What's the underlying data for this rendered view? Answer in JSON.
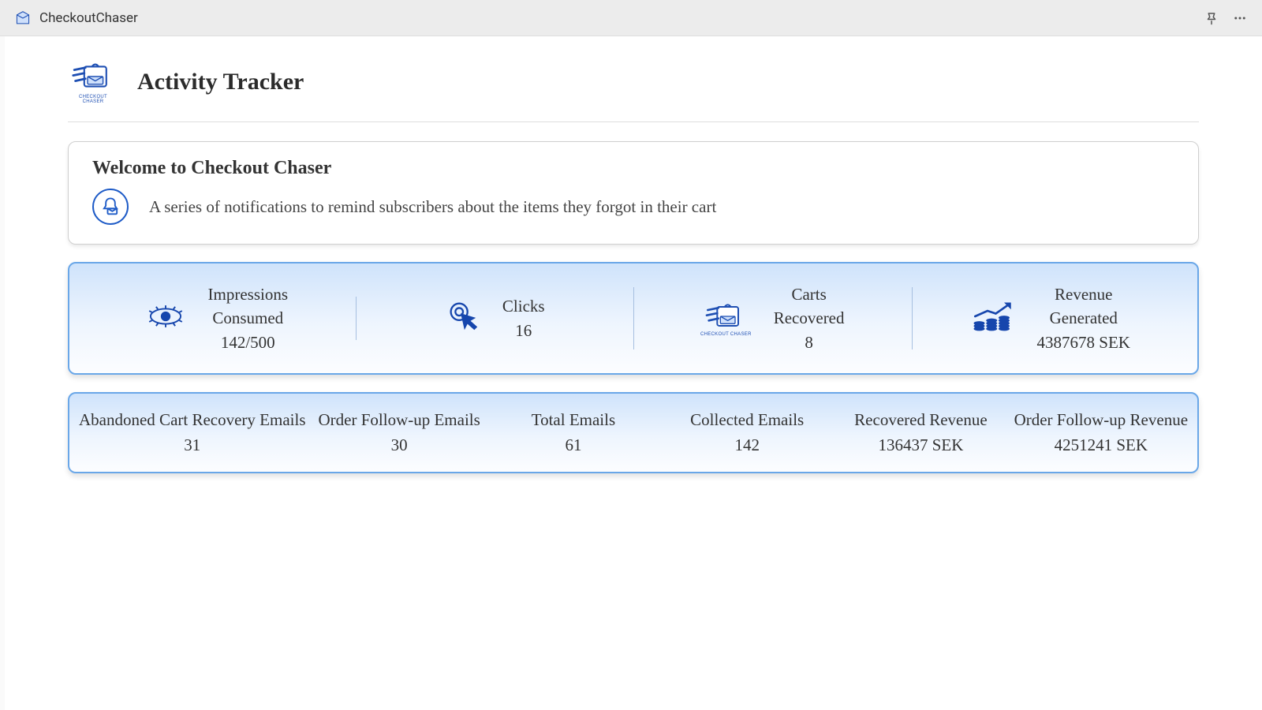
{
  "topbar": {
    "title": "CheckoutChaser"
  },
  "brand_caption": "CHECKOUT CHASER",
  "page": {
    "title": "Activity Tracker"
  },
  "welcome": {
    "title": "Welcome to Checkout Chaser",
    "description": "A series of notifications to remind subscribers about the items they forgot in their cart"
  },
  "stats": {
    "impressions": {
      "label_line1": "Impressions",
      "label_line2": "Consumed",
      "value": "142/500"
    },
    "clicks": {
      "label": "Clicks",
      "value": "16"
    },
    "carts": {
      "label_line1": "Carts",
      "label_line2": "Recovered",
      "value": "8"
    },
    "revenue": {
      "label_line1": "Revenue",
      "label_line2": "Generated",
      "value": "4387678 SEK"
    }
  },
  "emails": {
    "abandoned": {
      "label": "Abandoned Cart Recovery Emails",
      "value": "31"
    },
    "followup": {
      "label": "Order Follow-up Emails",
      "value": "30"
    },
    "total": {
      "label": "Total Emails",
      "value": "61"
    },
    "collected": {
      "label": "Collected Emails",
      "value": "142"
    },
    "recovered": {
      "label": "Recovered Revenue",
      "value": "136437 SEK"
    },
    "followup_rev": {
      "label": "Order Follow-up Revenue",
      "value": "4251241 SEK"
    }
  }
}
